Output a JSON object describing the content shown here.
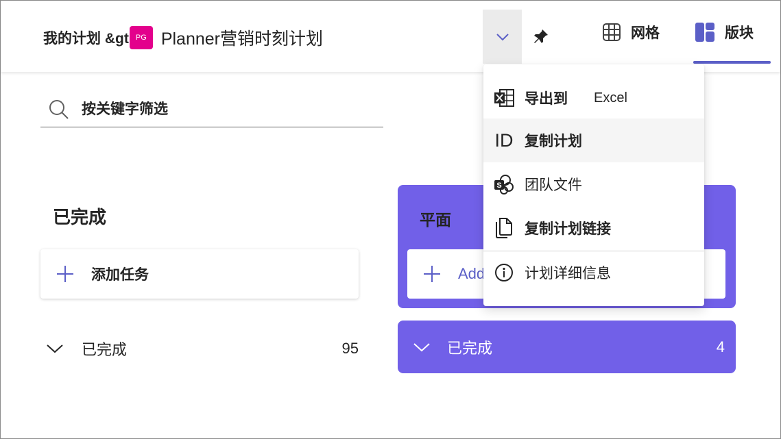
{
  "header": {
    "breadcrumb_root": "我的计划 &gt;",
    "plan_avatar": "PG",
    "plan_title": "Planner营销时刻计划",
    "tabs": {
      "grid": "网格",
      "board": "版块"
    }
  },
  "search": {
    "placeholder": "按关键字筛选"
  },
  "bucket_completed": {
    "title": "已完成",
    "add_task": "添加任务",
    "completed_label": "已完成",
    "completed_count": "95"
  },
  "bucket_purple": {
    "title": "平面",
    "add_task": "Add",
    "completed_label": "已完成",
    "completed_count": "4"
  },
  "menu": {
    "export": "导出到",
    "export_suffix": "Excel",
    "copy_id": "复制计划",
    "copy_id_glyph": "ID",
    "team_files": "团队文件",
    "copy_link": "复制计划链接",
    "plan_details": "计划详细信息"
  },
  "colors": {
    "accent": "#5b5fc7",
    "bucket_purple": "#7160e8",
    "avatar": "#e3008c"
  },
  "icons": {
    "search": "search-icon",
    "chevron": "chevron-down-icon",
    "pin": "pin-icon",
    "grid": "grid-icon",
    "board": "board-icon",
    "excel": "excel-icon",
    "sharepoint": "sharepoint-icon",
    "copy": "copy-icon",
    "info": "info-icon",
    "plus": "plus-icon"
  }
}
